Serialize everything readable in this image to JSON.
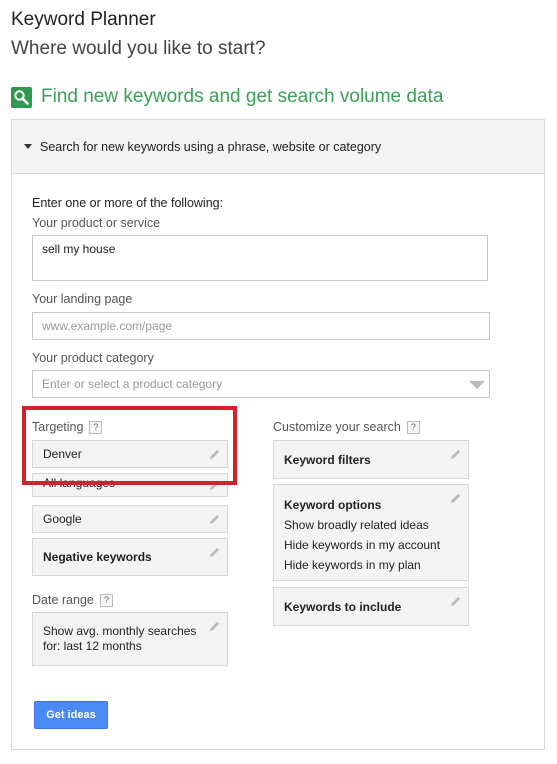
{
  "header": {
    "title": "Keyword Planner",
    "subtitle": "Where would you like to start?"
  },
  "section": {
    "title": "Find new keywords and get search volume data",
    "icon": "search-icon",
    "accent_color": "#3a9f57"
  },
  "panel": {
    "header_label": "Search for new keywords using a phrase, website or category",
    "intro": "Enter one or more of the following:",
    "product": {
      "label": "Your product or service",
      "value": "sell my house"
    },
    "landing": {
      "label": "Your landing page",
      "placeholder": "www.example.com/page"
    },
    "category": {
      "label": "Your product category",
      "placeholder": "Enter or select a product category"
    },
    "targeting": {
      "label": "Targeting",
      "help": "?",
      "location": "Denver",
      "language": "All languages",
      "network": "Google",
      "negative": "Negative keywords"
    },
    "date_range": {
      "label": "Date range",
      "help": "?",
      "line1": "Show avg. monthly searches",
      "line2": "for: last 12 months"
    },
    "customize": {
      "label": "Customize your search",
      "help": "?",
      "filters": "Keyword filters",
      "options_title": "Keyword options",
      "options": [
        "Show broadly related ideas",
        "Hide keywords in my account",
        "Hide keywords in my plan"
      ],
      "include": "Keywords to include"
    },
    "button_label": "Get ideas"
  },
  "colors": {
    "highlight": "#d3212d",
    "button": "#4a8af4"
  }
}
